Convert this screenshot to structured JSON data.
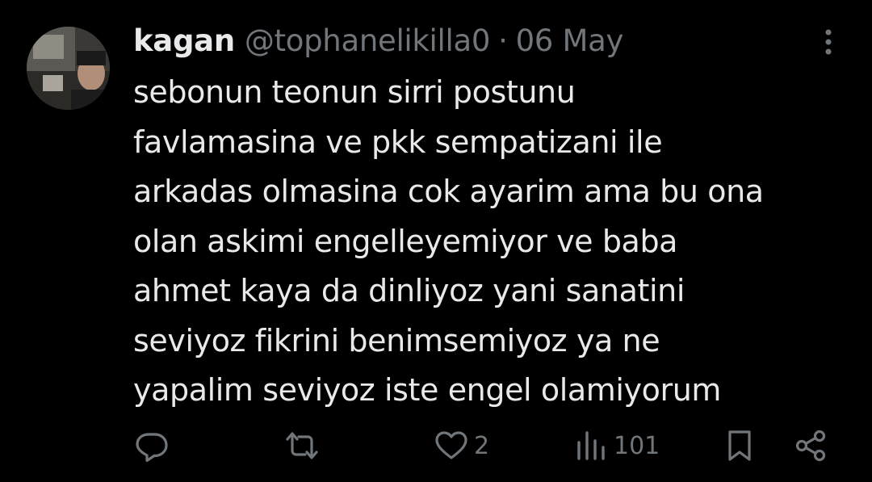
{
  "tweet": {
    "author_name": "kagan",
    "author_handle": "@tophanelikilla0",
    "separator": "·",
    "date": "06 May",
    "text": "sebonun teonun sirri postunu\nfavlamasina ve pkk sempatizani ile\narkadas olmasina cok ayarim ama bu ona\nolan askimi engelleyemiyor ve baba\nahmet kaya da dinliyoz yani sanatini\nseviyoz fikrini benimsemiyoz ya ne\nyapalim seviyoz iste engel olamiyorum"
  },
  "actions": {
    "reply_icon": "reply-icon",
    "retweet_icon": "retweet-icon",
    "like_icon": "heart-icon",
    "like_count": "2",
    "views_icon": "views-icon",
    "views_count": "101",
    "bookmark_icon": "bookmark-icon",
    "share_icon": "share-icon"
  },
  "colors": {
    "background": "#000000",
    "primary_text": "#e7e9ea",
    "secondary_text": "#71767b"
  }
}
